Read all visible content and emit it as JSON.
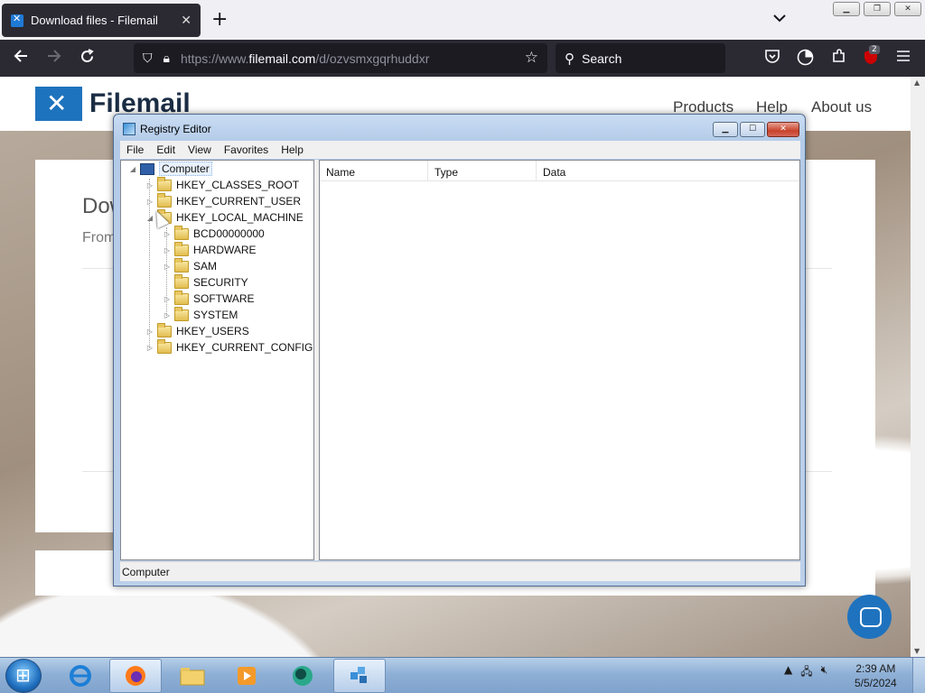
{
  "browser": {
    "tab_title": "Download files - Filemail",
    "tab_close": "✕",
    "new_tab": "+",
    "tab_list": "⌄",
    "url_prefix": "https://www.",
    "url_domain": "filemail.com",
    "url_path": "/d/ozvsmxgqrhuddxr",
    "search_placeholder": "Search",
    "extensions_badge": "2"
  },
  "page": {
    "logo_text": "Filemail",
    "nav": [
      "Products",
      "Help",
      "About us"
    ],
    "heading": "Dow",
    "subheading": "From"
  },
  "regedit": {
    "title": "Registry Editor",
    "menu": [
      "File",
      "Edit",
      "View",
      "Favorites",
      "Help"
    ],
    "tree_root": "Computer",
    "tree": [
      {
        "label": "HKEY_CLASSES_ROOT",
        "level": 1,
        "expander": "▷"
      },
      {
        "label": "HKEY_CURRENT_USER",
        "level": 1,
        "expander": "▷"
      },
      {
        "label": "HKEY_LOCAL_MACHINE",
        "level": 1,
        "expander": "◢"
      },
      {
        "label": "BCD00000000",
        "level": 2,
        "expander": "▷"
      },
      {
        "label": "HARDWARE",
        "level": 2,
        "expander": "▷"
      },
      {
        "label": "SAM",
        "level": 2,
        "expander": "▷"
      },
      {
        "label": "SECURITY",
        "level": 2,
        "expander": ""
      },
      {
        "label": "SOFTWARE",
        "level": 2,
        "expander": "▷"
      },
      {
        "label": "SYSTEM",
        "level": 2,
        "expander": "▷"
      },
      {
        "label": "HKEY_USERS",
        "level": 1,
        "expander": "▷"
      },
      {
        "label": "HKEY_CURRENT_CONFIG",
        "level": 1,
        "expander": "▷"
      }
    ],
    "columns": [
      "Name",
      "Type",
      "Data"
    ],
    "status": "Computer"
  },
  "taskbar": {
    "time": "2:39 AM",
    "date": "5/5/2024"
  },
  "colors": {
    "accent": "#1e73be",
    "browser_dark": "#2b2a33"
  }
}
